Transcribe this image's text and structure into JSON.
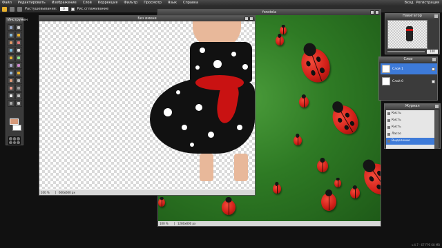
{
  "menu": {
    "items": [
      "Файл",
      "Редактировать",
      "Изображение",
      "Слой",
      "Коррекция",
      "Фильтр",
      "Просмотр",
      "Язык",
      "Справка"
    ],
    "right": [
      "Вход",
      "Регистрация"
    ]
  },
  "options": {
    "feather_label": "Растушевывание:",
    "feather_value": "0",
    "antialias_label": "Рис.сглаживание"
  },
  "tools_panel": {
    "title": "Инструмен"
  },
  "documents": {
    "untitled": {
      "title": "Без имени",
      "zoom": "100 %",
      "size": "600x600 px"
    },
    "fonstola": {
      "title": "fonstola",
      "zoom": "100 %",
      "size": "1280x800 px"
    }
  },
  "navigator": {
    "title": "Навигатор",
    "zoom": "100"
  },
  "layers_panel": {
    "title": "Слои",
    "layers": [
      {
        "name": "Слой 1",
        "active": true
      },
      {
        "name": "Слой 0",
        "active": false
      }
    ]
  },
  "history_panel": {
    "title": "Журнал",
    "items": [
      {
        "label": "Кисть",
        "active": false
      },
      {
        "label": "Кисть",
        "active": false
      },
      {
        "label": "Кисть",
        "active": false
      },
      {
        "label": "Лассо",
        "active": false
      },
      {
        "label": "Выделение",
        "active": true
      }
    ]
  },
  "footer": {
    "version": "v.4.7 · 67 FPS 68 MB"
  },
  "colors": {
    "accent": "#3d7ad8",
    "foreground": "#d79a7a",
    "leaf": "#2e7a24",
    "ladybug": "#d11f18"
  }
}
